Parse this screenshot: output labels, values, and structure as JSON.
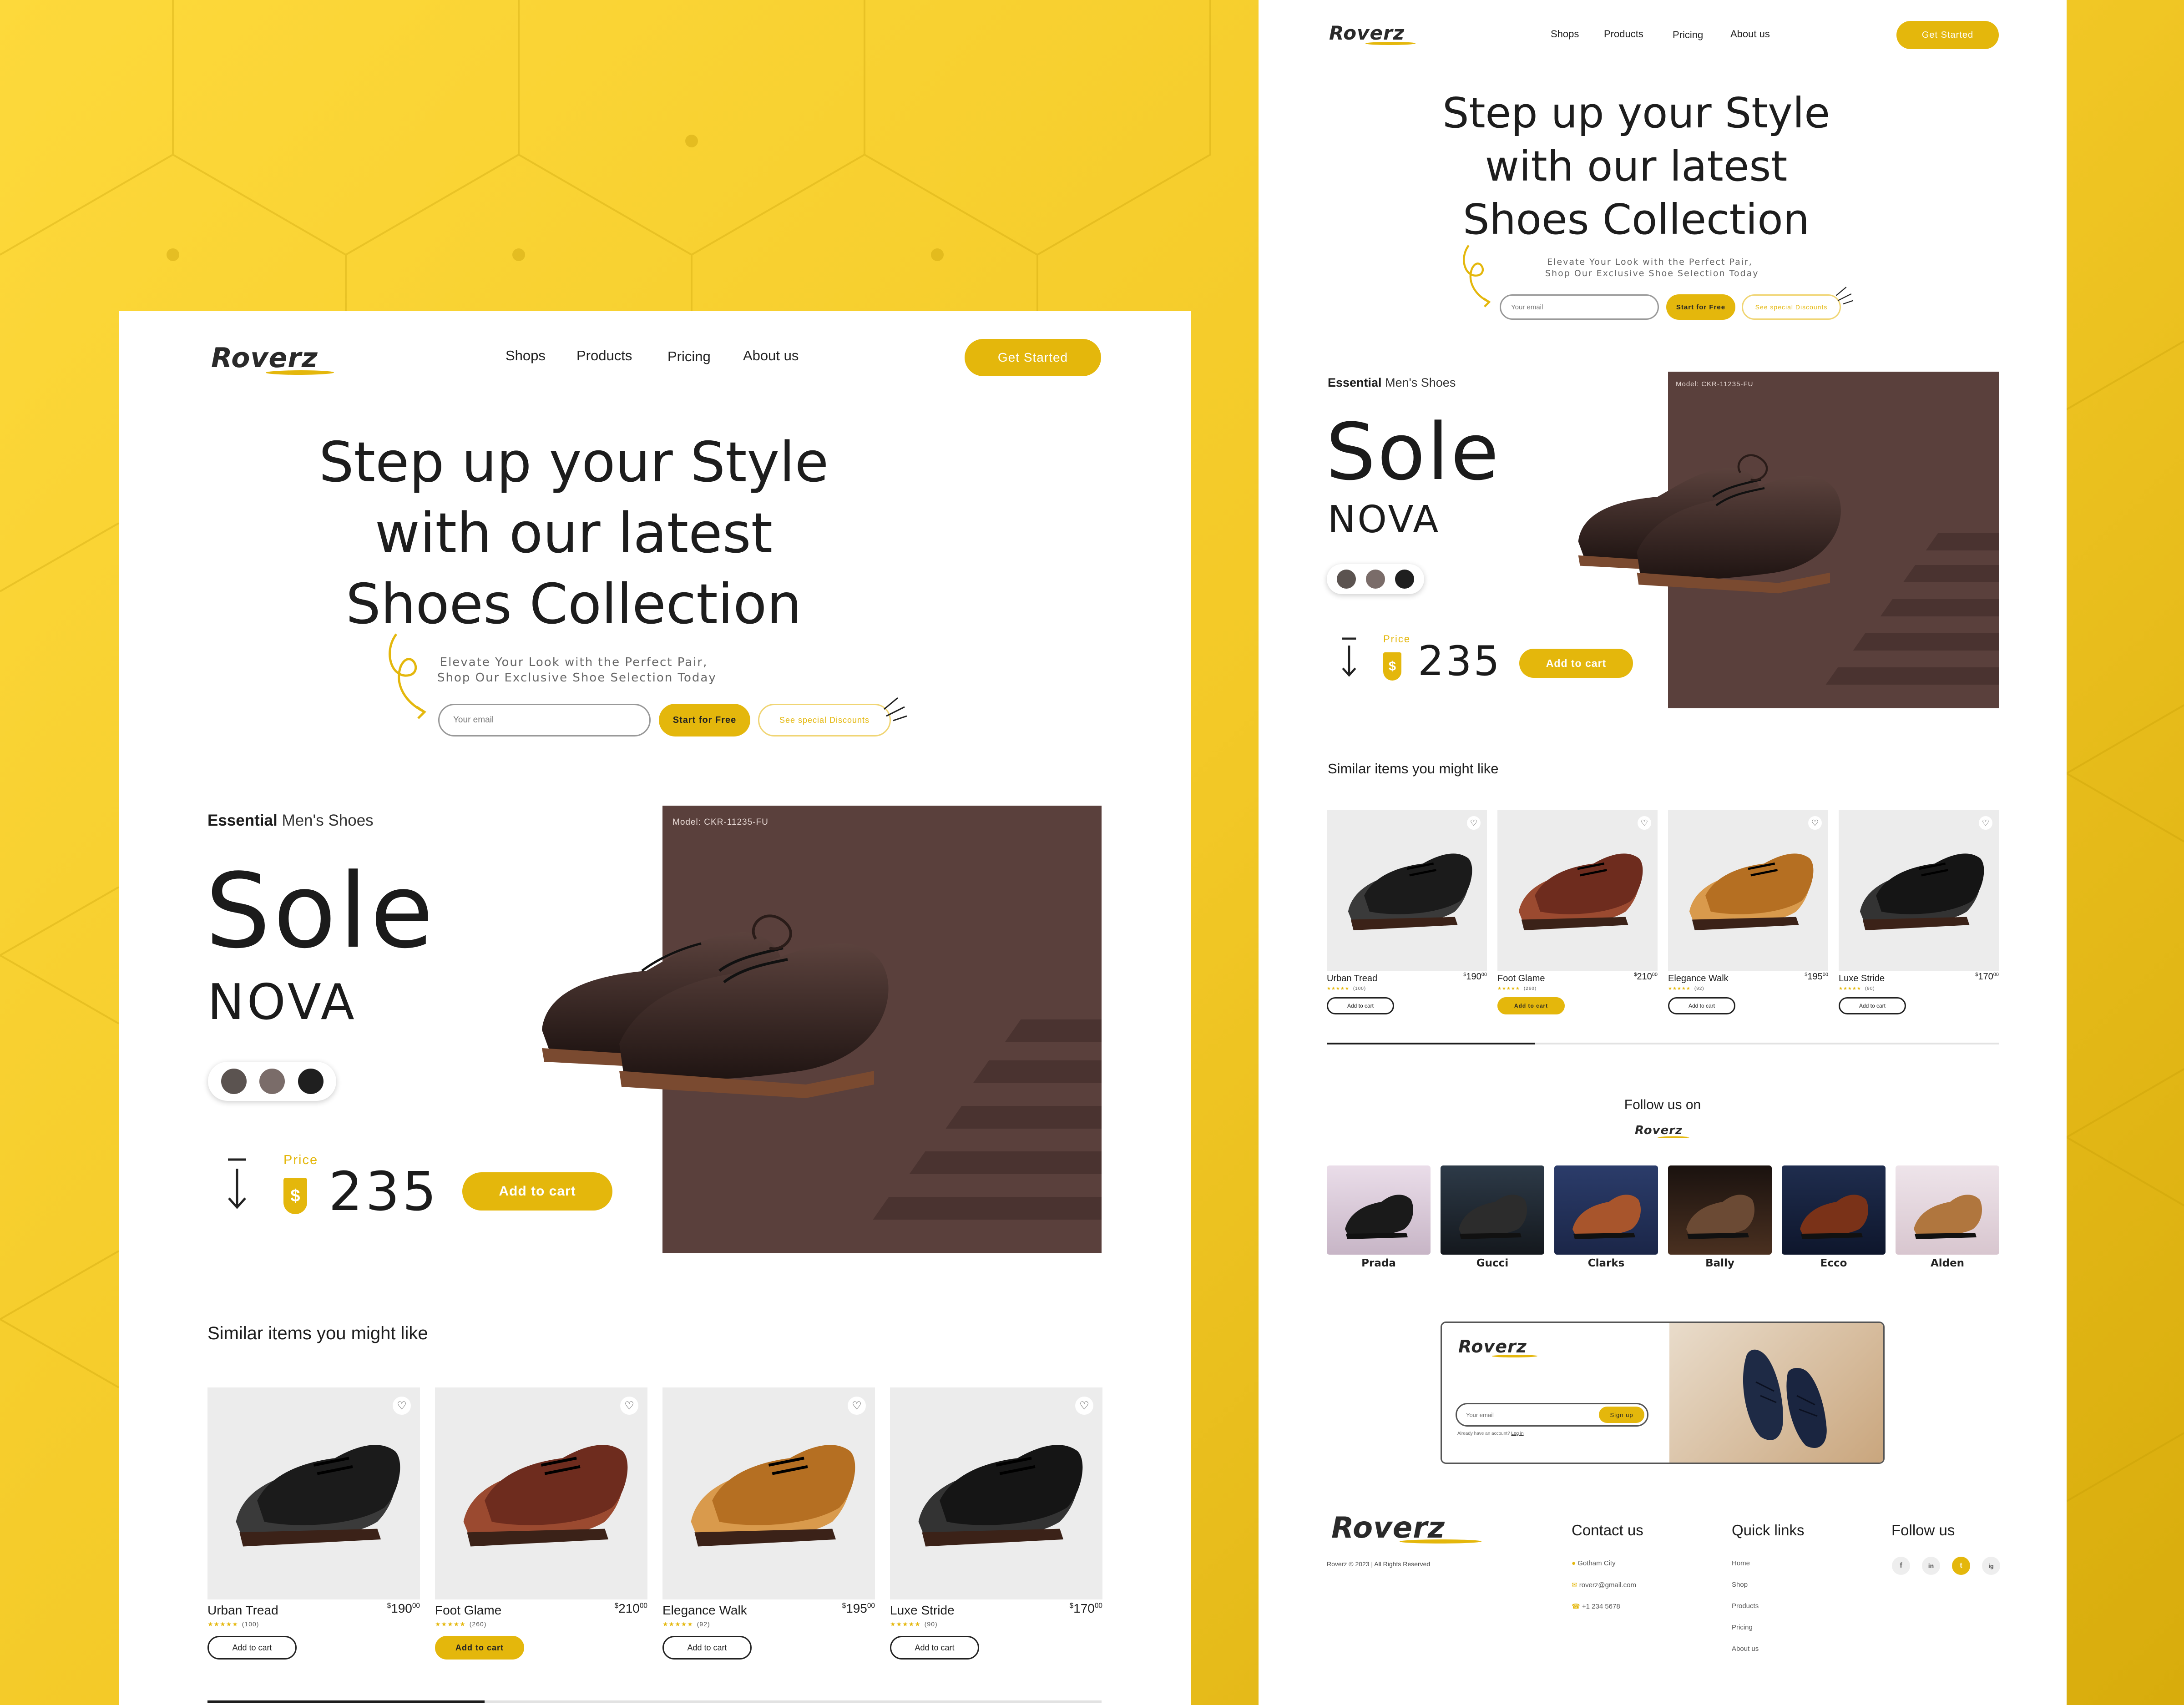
{
  "colors": {
    "accent": "#e4b70c",
    "product_bg": "#5a403c",
    "card_bg": "#ececec",
    "text": "#1d1d1d"
  },
  "brand": {
    "logo": "Roverz"
  },
  "nav": {
    "items": [
      "Shops",
      "Products",
      "Pricing",
      "About us"
    ],
    "cta": "Get Started"
  },
  "hero": {
    "title_lines": [
      "Step up your Style",
      "with our latest",
      "Shoes Collection"
    ],
    "subtitle_lines": [
      "Elevate Your Look with the Perfect Pair,",
      "Shop Our Exclusive Shoe Selection Today"
    ],
    "email_placeholder": "Your email",
    "primary_cta": "Start for Free",
    "secondary_cta": "See special Discounts"
  },
  "product": {
    "category_bold": "Essential",
    "category_rest": "Men's Shoes",
    "name_line1": "Sole",
    "name_line2": "NOVA",
    "model": "Model: CKR-11235-FU",
    "swatches": [
      "#5b5350",
      "#7a6c69",
      "#1f1f1f"
    ],
    "price_label": "Price",
    "currency_symbol": "$",
    "price": "235",
    "add_to_cart": "Add to cart",
    "arrow": "down-arrow-icon"
  },
  "similar": {
    "title": "Similar items you might like",
    "items": [
      {
        "name": "Urban Tread",
        "price": "190",
        "cents": "00",
        "stars": "★★★★★",
        "reviews": "(100)",
        "button": "Add to cart",
        "active": false
      },
      {
        "name": "Foot Glame",
        "price": "210",
        "cents": "00",
        "stars": "★★★★★",
        "reviews": "(260)",
        "button": "Add to cart",
        "active": true
      },
      {
        "name": "Elegance Walk",
        "price": "195",
        "cents": "00",
        "stars": "★★★★★",
        "reviews": "(92)",
        "button": "Add to cart",
        "active": false
      },
      {
        "name": "Luxe Stride",
        "price": "170",
        "cents": "00",
        "stars": "★★★★★",
        "reviews": "(90)",
        "button": "Add to cart",
        "active": false
      }
    ],
    "scroll_progress": 0.31
  },
  "follow": {
    "title": "Follow us on",
    "logo": "Roverz",
    "brands": [
      "Prada",
      "Gucci",
      "Clarks",
      "Bally",
      "Ecco",
      "Alden"
    ]
  },
  "signup": {
    "logo": "Roverz",
    "email_placeholder": "Your email",
    "button": "Sign up",
    "note": "Already have an account?",
    "login": "Log in"
  },
  "footer": {
    "logo": "Roverz",
    "copyright": "Roverz © 2023 | All Rights Reserved",
    "contact_title": "Contact us",
    "contact": [
      "Gotham City",
      "roverz@gmail.com",
      "+1 234 5678"
    ],
    "quick_title": "Quick links",
    "quick": [
      "Home",
      "Shop",
      "Products",
      "Pricing",
      "About us"
    ],
    "follow_title": "Follow us",
    "socials": [
      "f",
      "in",
      "t",
      "ig"
    ]
  }
}
